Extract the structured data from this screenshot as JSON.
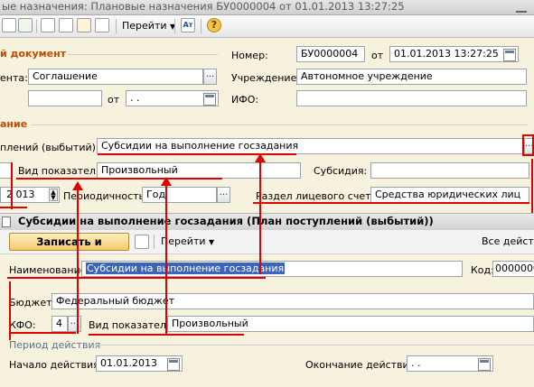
{
  "window": {
    "title": "ые назначения: Плановые назначения БУ0000004 от 01.01.2013 13:27:25"
  },
  "toolbar": {
    "goto_label": "Перейти",
    "help_icon": "question-icon"
  },
  "main": {
    "section_doc": "й документ",
    "number_label": "Номер:",
    "number_value": "БУ0000004",
    "from_label": "от",
    "date_value": "01.01.2013 13:27:25",
    "agreement_label": "ента:",
    "agreement_value": "Соглашение",
    "institution_label": "Учреждение:",
    "institution_value": "Автономное учреждение",
    "from2_label": "от",
    "empty_date_value": " .  .",
    "ifo_label": "ИФО:",
    "section_purpose": "ание",
    "plan_label": "плений (выбытий):",
    "plan_value": "Субсидии на выполнение госзадания",
    "indicator_label": "Вид показателя:",
    "indicator_value": "Произвольный",
    "subsidy_label": "Субсидия:",
    "year_value": "2 013",
    "periodicity_label": "Периодичность:",
    "periodicity_value": "Год",
    "account_label": "Раздел лицевого счета:",
    "account_value": "Средства юридических лиц"
  },
  "subform": {
    "title": "Субсидии на выполнение госзадания (План поступлений (выбытий))",
    "save_close_label": "Записать и закрыть",
    "goto_label": "Перейти",
    "all_actions_label": "Все действ",
    "name_label": "Наименование:",
    "name_value": "Субсидии на выполнение госзадания",
    "code_label": "Код:",
    "code_value": "0000000",
    "budget_label": "Бюджет:",
    "budget_value": "Федеральный бюджет",
    "kfo_label": "КФО:",
    "kfo_value": "4",
    "indicator_label": "Вид показателя:",
    "indicator_value": "Произвольный",
    "period_section": "Период действия",
    "start_label": "Начало действия:",
    "start_value": "01.01.2013",
    "end_label": "Окончание действия:",
    "end_value": " .  ."
  },
  "colors": {
    "annotation": "#e10000",
    "section": "#c24b00",
    "background": "#f7f2dd"
  }
}
